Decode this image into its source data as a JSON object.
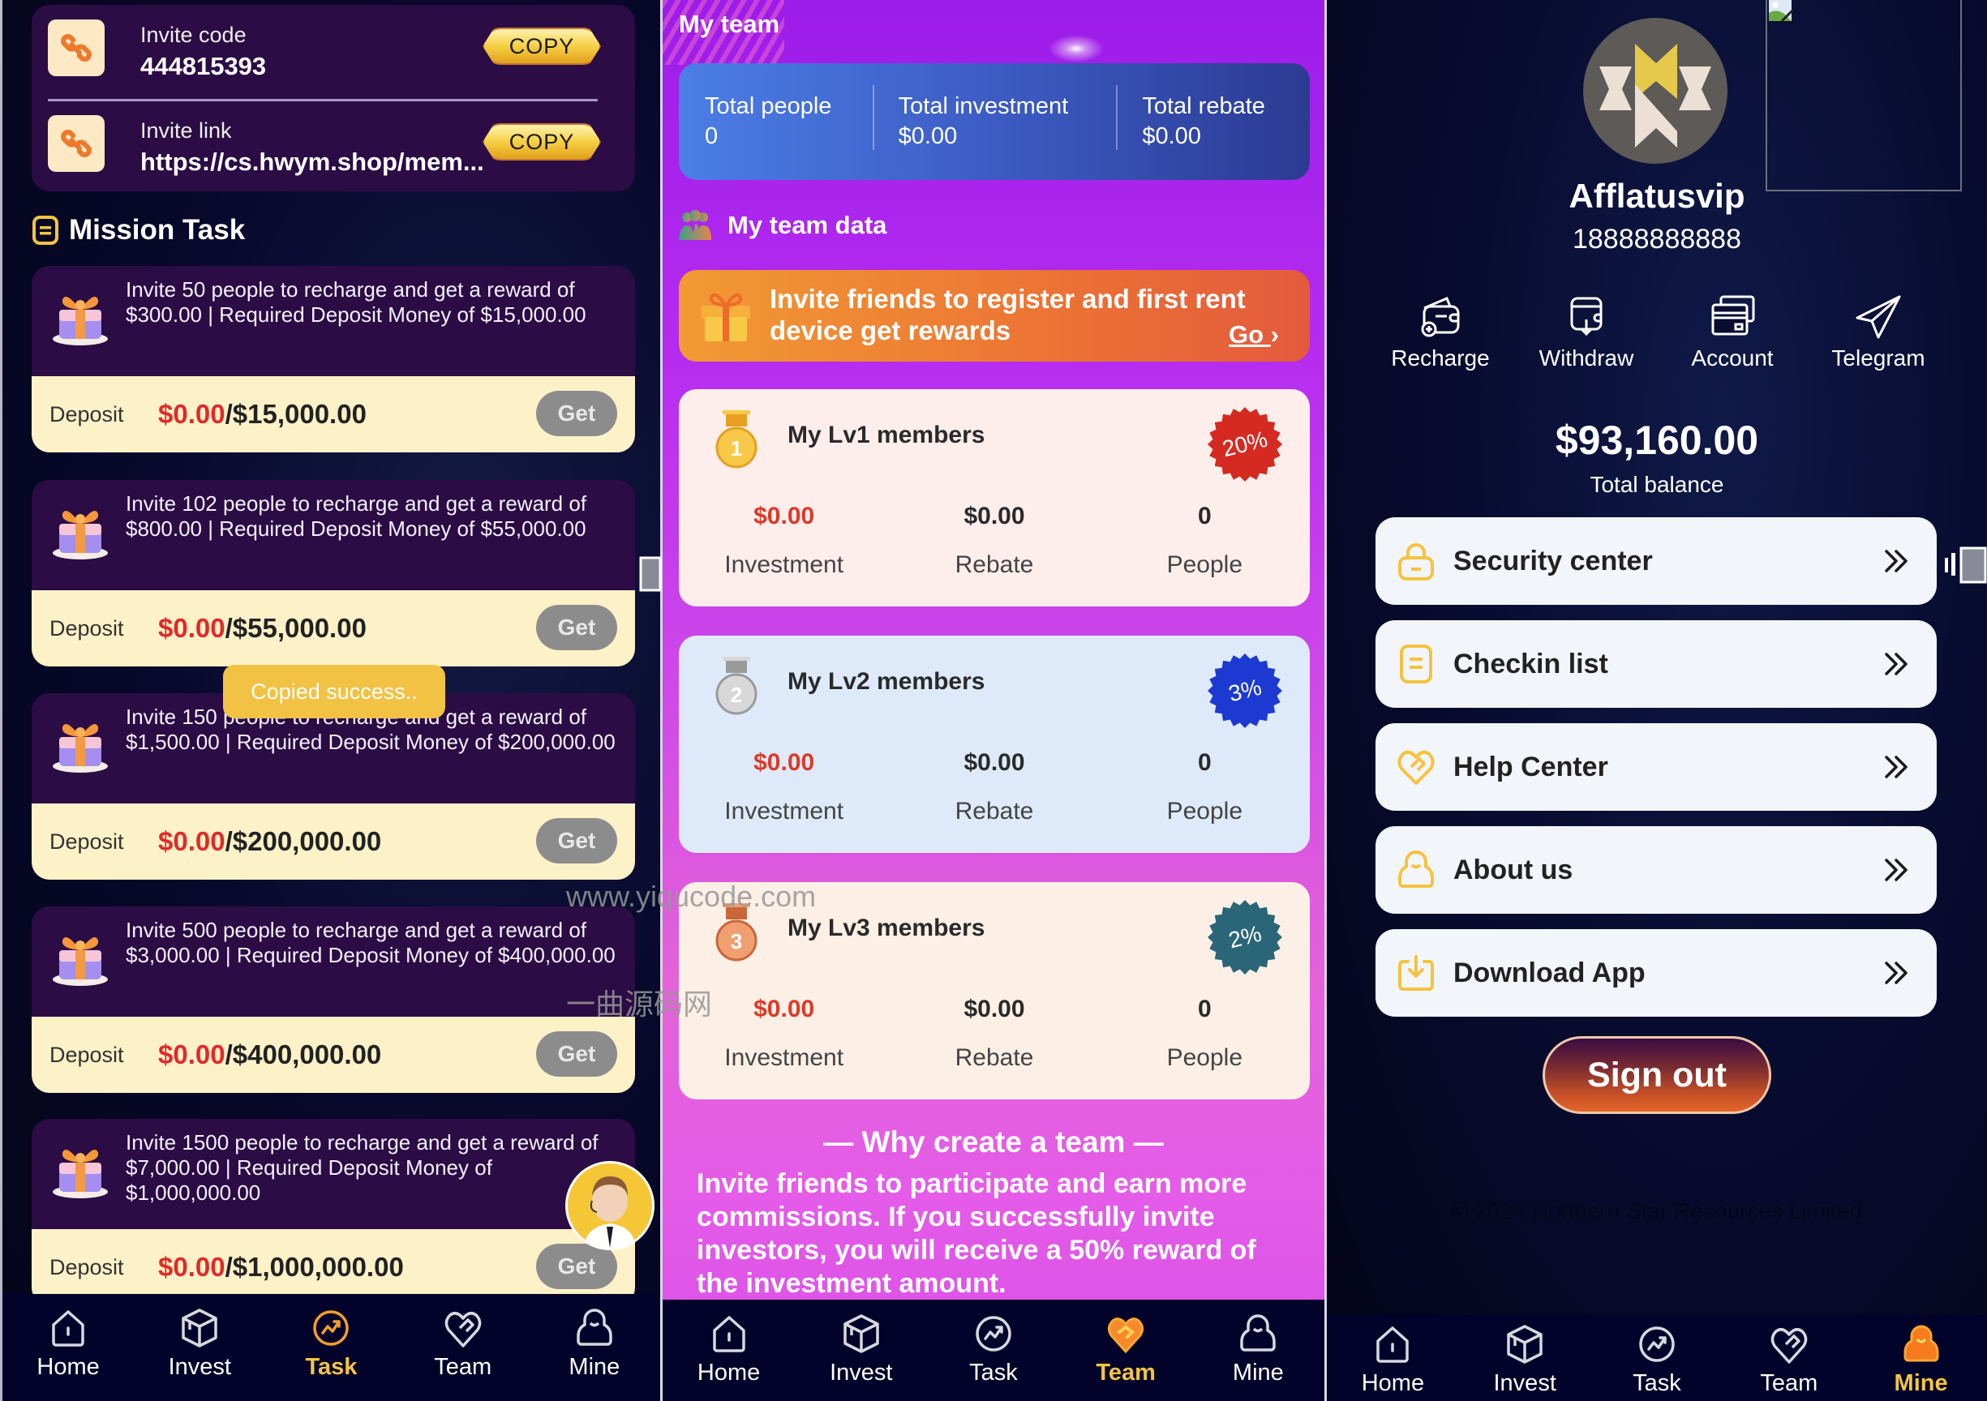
{
  "task_screen": {
    "invite": {
      "code_label": "Invite code",
      "code_value": "444815393",
      "link_label": "Invite link",
      "link_value": "https://cs.hwym.shop/mem...",
      "copy_label": "COPY"
    },
    "mission_title": "Mission Task",
    "deposit_label": "Deposit",
    "get_label": "Get",
    "tasks": [
      {
        "text": "Invite 50 people to recharge and get a reward of $300.00 | Required Deposit Money of $15,000.00",
        "current": "$0.00",
        "target": "/$15,000.00"
      },
      {
        "text": "Invite 102 people to recharge and get a reward of $800.00 | Required Deposit Money of $55,000.00",
        "current": "$0.00",
        "target": "/$55,000.00"
      },
      {
        "text": "Invite 150 people to recharge and get a reward of $1,500.00 | Required Deposit Money of $200,000.00",
        "current": "$0.00",
        "target": "/$200,000.00"
      },
      {
        "text": "Invite 500 people to recharge and get a reward of $3,000.00 | Required Deposit Money of $400,000.00",
        "current": "$0.00",
        "target": "/$400,000.00"
      },
      {
        "text": "Invite 1500 people to recharge and get a reward of $7,000.00 | Required Deposit Money of $1,000,000.00",
        "current": "$0.00",
        "target": "/$1,000,000.00"
      }
    ],
    "toast": "Copied success..",
    "active_tab": "Task"
  },
  "team_screen": {
    "title": "My team",
    "stats": [
      {
        "label": "Total people",
        "value": "0"
      },
      {
        "label": "Total investment",
        "value": "$0.00"
      },
      {
        "label": "Total rebate",
        "value": "$0.00"
      }
    ],
    "team_data_title": "My team data",
    "banner": {
      "text": "Invite friends to register and first rent device get rewards",
      "go_label": "Go"
    },
    "levels": [
      {
        "title": "My Lv1 members",
        "rate": "20%",
        "investment": "$0.00",
        "rebate": "$0.00",
        "people": "0",
        "medal": "1"
      },
      {
        "title": "My Lv2 members",
        "rate": "3%",
        "investment": "$0.00",
        "rebate": "$0.00",
        "people": "0",
        "medal": "2"
      },
      {
        "title": "My Lv3 members",
        "rate": "2%",
        "investment": "$0.00",
        "rebate": "$0.00",
        "people": "0",
        "medal": "3"
      }
    ],
    "col_labels": {
      "investment": "Investment",
      "rebate": "Rebate",
      "people": "People"
    },
    "why_title": "— Why create a team —",
    "why_body": "Invite friends to participate and earn more commissions. If you successfully invite investors, you will receive a 50% reward of the investment amount.",
    "active_tab": "Team"
  },
  "mine_screen": {
    "username": "Afflatusvip",
    "phone": "18888888888",
    "actions": [
      {
        "label": "Recharge",
        "icon": "wallet-plus-icon"
      },
      {
        "label": "Withdraw",
        "icon": "wallet-download-icon"
      },
      {
        "label": "Account",
        "icon": "cards-icon"
      },
      {
        "label": "Telegram",
        "icon": "paper-plane-icon"
      }
    ],
    "balance": "$93,160.00",
    "balance_label": "Total balance",
    "menu": [
      {
        "label": "Security center",
        "icon": "lock-icon"
      },
      {
        "label": "Checkin list",
        "icon": "list-icon"
      },
      {
        "label": "Help Center",
        "icon": "heart-hand-icon"
      },
      {
        "label": "About us",
        "icon": "person-icon"
      },
      {
        "label": "Download App",
        "icon": "download-icon"
      }
    ],
    "signout_label": "Sign out",
    "footer": "© 2024 Northern Star Resources Limited",
    "active_tab": "Mine"
  },
  "nav": {
    "items": [
      {
        "label": "Home",
        "icon": "home-icon"
      },
      {
        "label": "Invest",
        "icon": "cube-icon"
      },
      {
        "label": "Task",
        "icon": "trend-icon"
      },
      {
        "label": "Team",
        "icon": "heart-hand-icon"
      },
      {
        "label": "Mine",
        "icon": "person-icon"
      }
    ]
  },
  "watermark": {
    "url": "www.yiqucode.com",
    "cn": "一曲源码网"
  },
  "colors": {
    "accent_gold": "#f2c542",
    "danger_red": "#e02a2a",
    "task_dark": "#2c0c44",
    "task_light": "#fdf1c8"
  }
}
